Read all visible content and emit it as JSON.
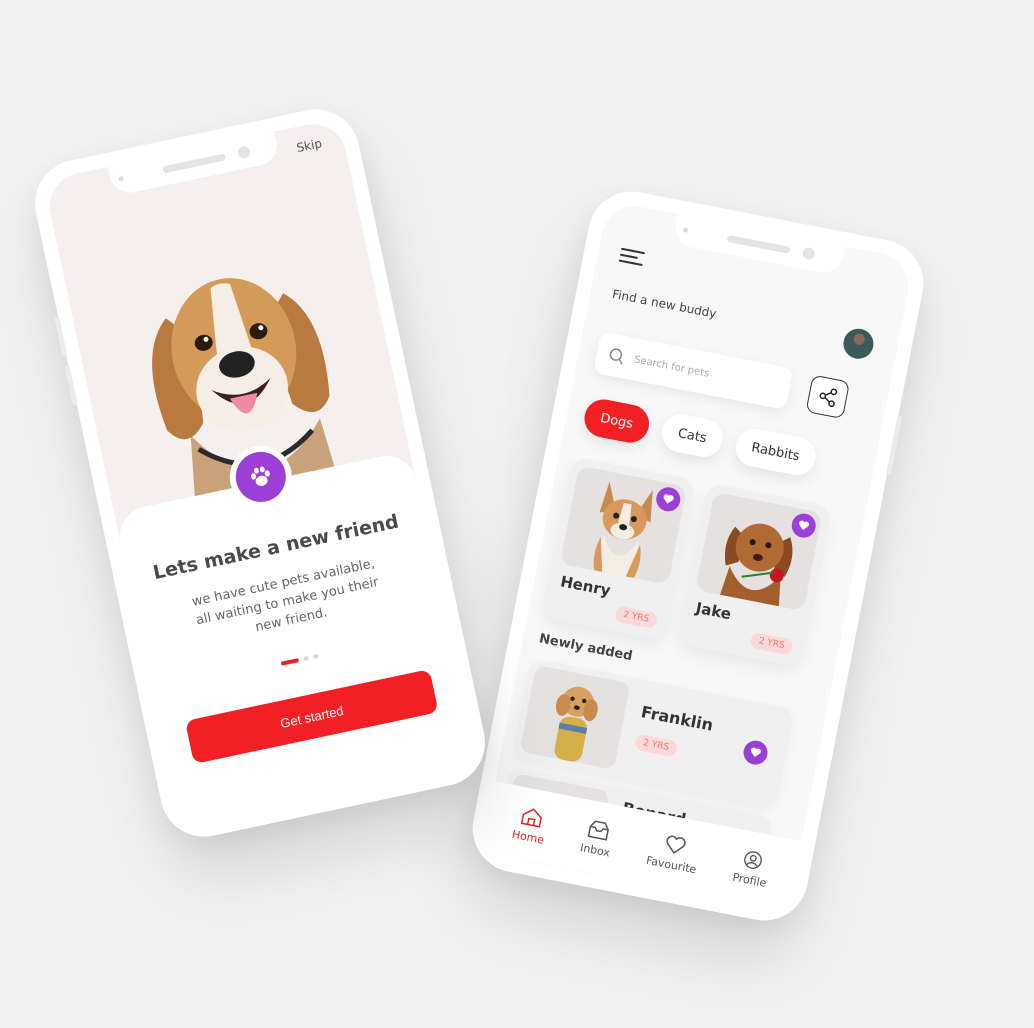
{
  "onboarding": {
    "skip_label": "Skip",
    "title": "Lets make a new friend",
    "description": "we have cute pets available, all waiting to make you their new friend.",
    "pager": {
      "total": 3,
      "active": 1
    },
    "cta_label": "Get started",
    "accent_color": "#f21f24",
    "badge_color": "#9b3fd6",
    "badge_icon": "paw-icon"
  },
  "home": {
    "menu_icon": "hamburger-icon",
    "greeting": "Find a new buddy",
    "search": {
      "placeholder": "Search for pets",
      "icon": "search-icon"
    },
    "share_icon": "share-icon",
    "categories": [
      {
        "label": "Dogs",
        "active": true
      },
      {
        "label": "Cats",
        "active": false
      },
      {
        "label": "Rabbits",
        "active": false
      }
    ],
    "featured_pets": [
      {
        "name": "Henry",
        "age": "2 YRS",
        "favourite": true
      },
      {
        "name": "Jake",
        "age": "2 YRS",
        "favourite": true
      }
    ],
    "newly_added_title": "Newly added",
    "newly_added": [
      {
        "name": "Franklin",
        "age": "2 YRS",
        "favourite": true
      },
      {
        "name": "Benard",
        "age": "",
        "favourite": true
      }
    ],
    "tabs": [
      {
        "label": "Home",
        "icon": "home-icon",
        "active": true
      },
      {
        "label": "Inbox",
        "icon": "inbox-icon",
        "active": false
      },
      {
        "label": "Favourite",
        "icon": "heart-icon",
        "active": false
      },
      {
        "label": "Profile",
        "icon": "profile-icon",
        "active": false
      }
    ],
    "accent_color": "#f21f24",
    "heart_color": "#9b3fd6"
  }
}
